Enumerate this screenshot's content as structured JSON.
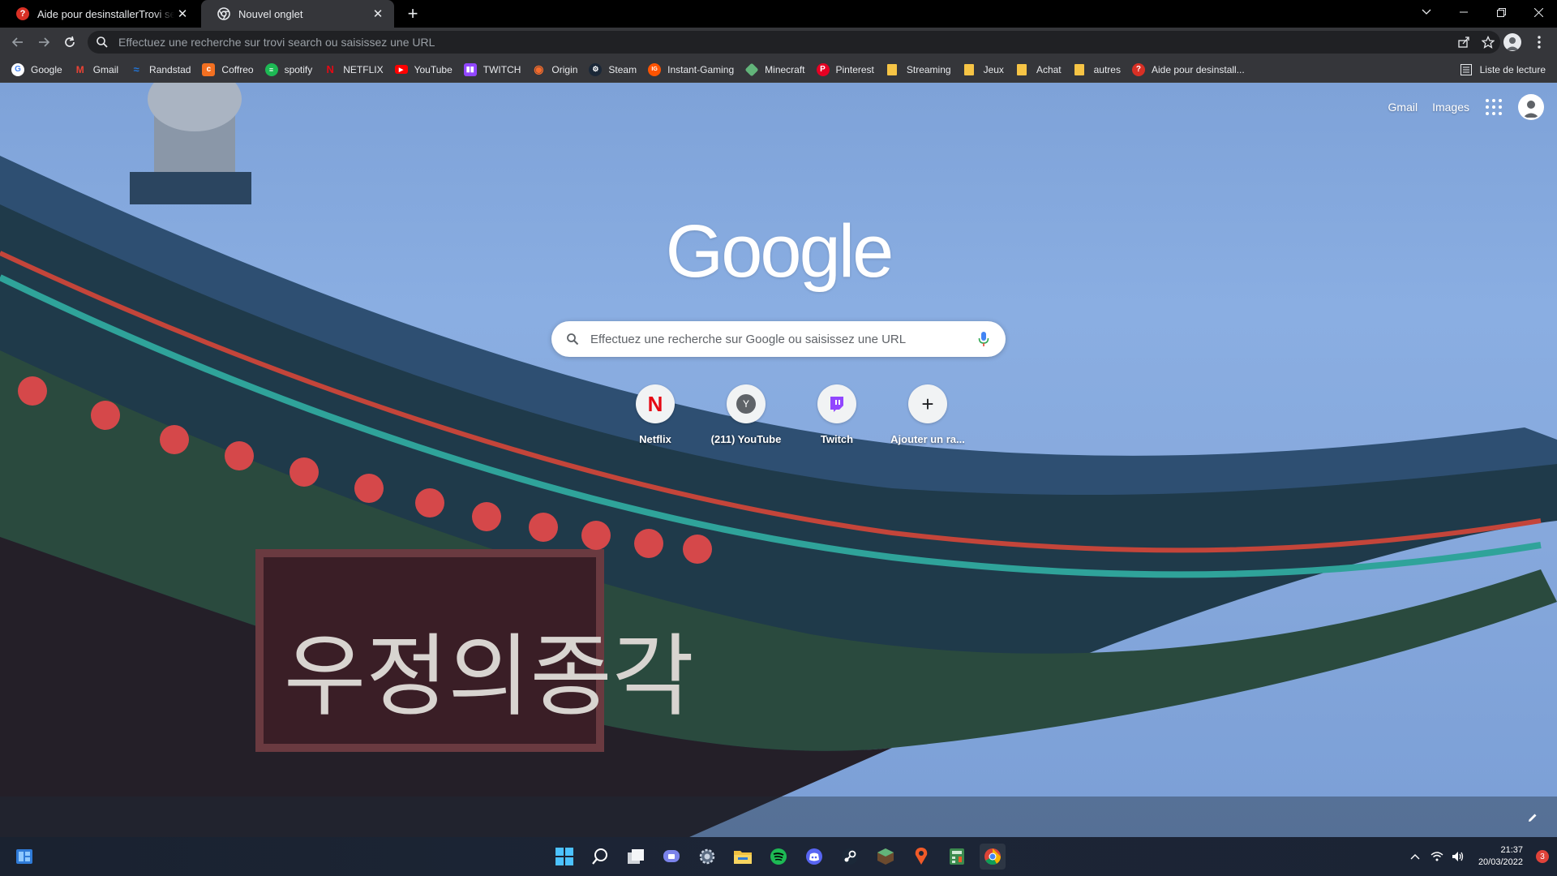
{
  "tabs": [
    {
      "title": "Aide pour desinstallerTrovi search",
      "active": false,
      "icon": "help-icon"
    },
    {
      "title": "Nouvel onglet",
      "active": true,
      "icon": "chrome-icon"
    }
  ],
  "omnibox": {
    "placeholder": "Effectuez une recherche sur trovi search ou saisissez une URL"
  },
  "bookmarks": [
    {
      "label": "Google",
      "icon": "google-icon",
      "color": "#ffffff"
    },
    {
      "label": "Gmail",
      "icon": "gmail-icon",
      "color": "#ea4335"
    },
    {
      "label": "Randstad",
      "icon": "randstad-icon",
      "color": "#2175d9"
    },
    {
      "label": "Coffreo",
      "icon": "coffreo-icon",
      "color": "#f37021"
    },
    {
      "label": "spotify",
      "icon": "spotify-icon",
      "color": "#1db954"
    },
    {
      "label": "NETFLIX",
      "icon": "netflix-icon",
      "color": "#e50914"
    },
    {
      "label": "YouTube",
      "icon": "youtube-icon",
      "color": "#ff0000"
    },
    {
      "label": "TWITCH",
      "icon": "twitch-icon",
      "color": "#9146ff"
    },
    {
      "label": "Origin",
      "icon": "origin-icon",
      "color": "#f56c2d"
    },
    {
      "label": "Steam",
      "icon": "steam-icon",
      "color": "#1b2838"
    },
    {
      "label": "Instant-Gaming",
      "icon": "instant-gaming-icon",
      "color": "#ff5400"
    },
    {
      "label": "Minecraft",
      "icon": "minecraft-icon",
      "color": "#62b47a"
    },
    {
      "label": "Pinterest",
      "icon": "pinterest-icon",
      "color": "#e60023"
    },
    {
      "label": "Streaming",
      "icon": "folder-icon",
      "color": "#f6c445"
    },
    {
      "label": "Jeux",
      "icon": "folder-icon",
      "color": "#f6c445"
    },
    {
      "label": "Achat",
      "icon": "folder-icon",
      "color": "#f6c445"
    },
    {
      "label": "autres",
      "icon": "folder-icon",
      "color": "#f6c445"
    },
    {
      "label": "Aide pour desinstall...",
      "icon": "help-icon",
      "color": "#d93025"
    }
  ],
  "reading_list": {
    "label": "Liste de lecture"
  },
  "ntp": {
    "top_links": {
      "gmail": "Gmail",
      "images": "Images"
    },
    "logo": "Google",
    "search_placeholder": "Effectuez une recherche sur Google ou saisissez une URL",
    "shortcuts": [
      {
        "label": "Netflix",
        "glyph": "N",
        "icon": "netflix-icon"
      },
      {
        "label": "(211) YouTube",
        "glyph": "Y",
        "icon": "youtube-letter-icon"
      },
      {
        "label": "Twitch",
        "glyph": "",
        "icon": "twitch-icon"
      },
      {
        "label": "Ajouter un ra...",
        "glyph": "+",
        "icon": "plus-icon"
      }
    ]
  },
  "taskbar": {
    "apps": [
      "start-icon",
      "search-icon",
      "task-view-icon",
      "teams-chat-icon",
      "settings-icon",
      "file-explorer-icon",
      "spotify-icon",
      "discord-icon",
      "steam-icon",
      "minecraft-icon",
      "maps-icon",
      "calculator-icon",
      "chrome-icon"
    ],
    "time": "21:37",
    "date": "20/03/2022",
    "notifications": "3"
  },
  "colors": {
    "accent": "#8ab4f8",
    "tab_active": "#35363a",
    "toolbar": "#35363a"
  }
}
